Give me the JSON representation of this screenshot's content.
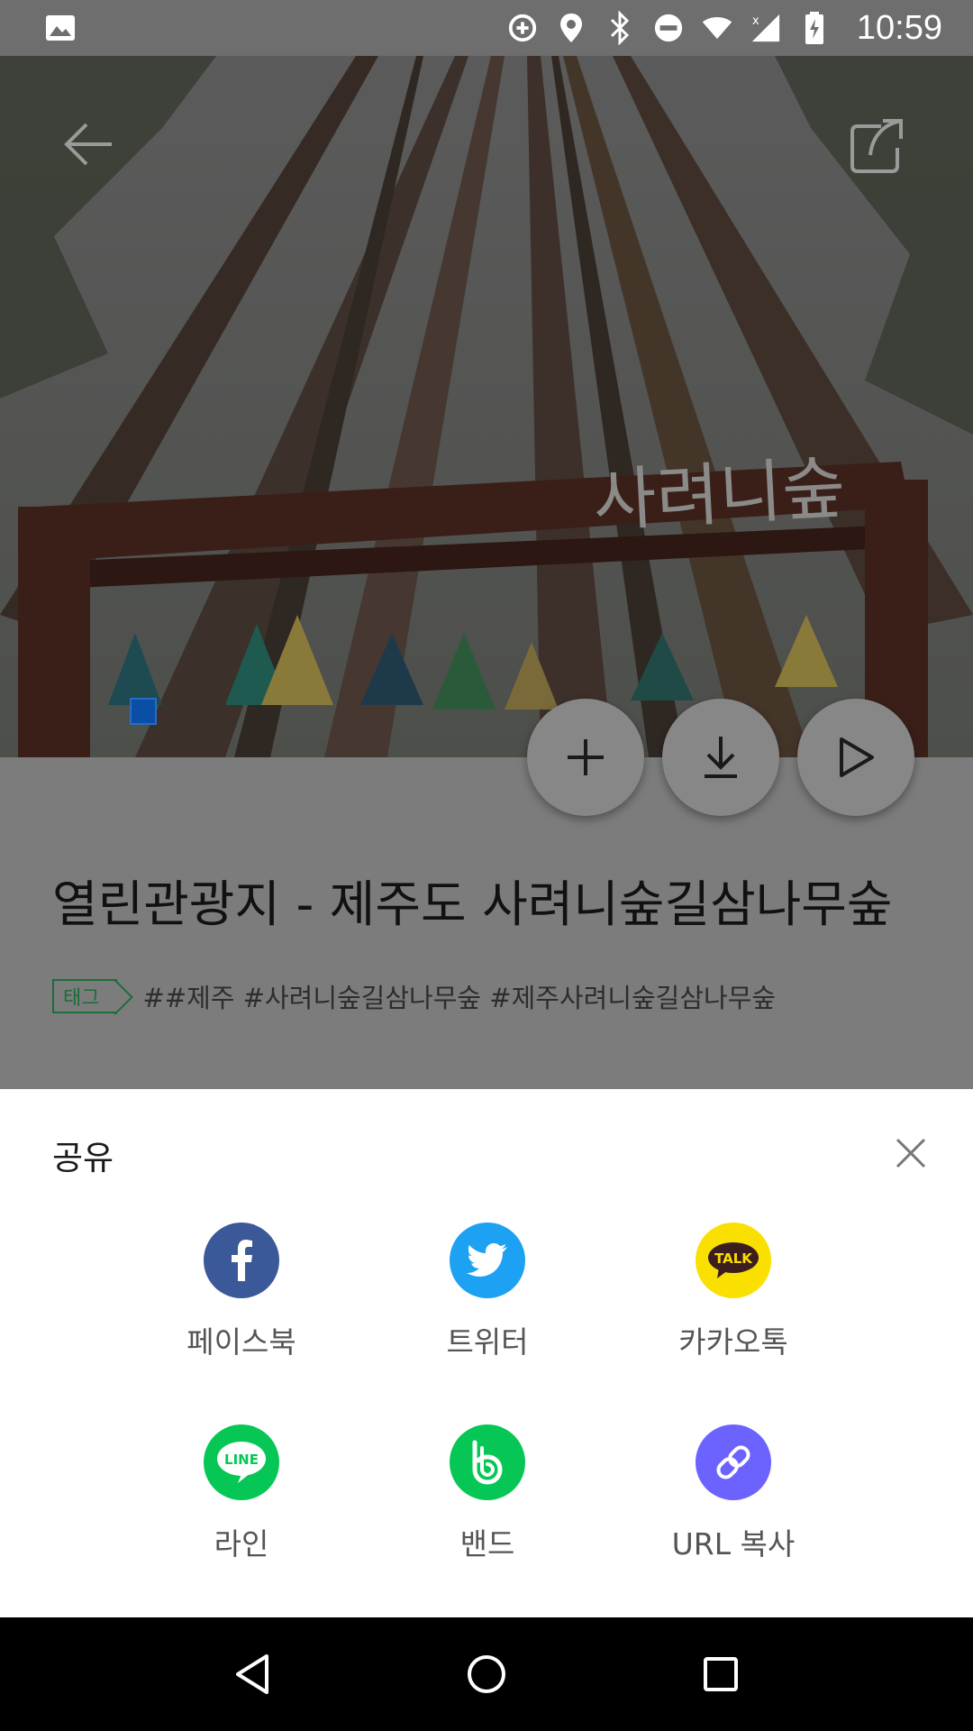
{
  "status_bar": {
    "time": "10:59",
    "icons": [
      "image-icon",
      "data-saver-icon",
      "location-icon",
      "bluetooth-icon",
      "do-not-disturb-icon",
      "wifi-icon",
      "signal-icon",
      "battery-charging-icon"
    ]
  },
  "hero": {
    "sign_text": "사려니숲",
    "back_icon": "arrow-left-icon",
    "share_icon": "share-icon"
  },
  "actions": {
    "add_icon": "plus-icon",
    "download_icon": "download-icon",
    "play_icon": "play-icon"
  },
  "content": {
    "title": "열린관광지 - 제주도 사려니숲길삼나무숲",
    "tag_badge": "태그",
    "tags": "##제주 #사려니숲길삼나무숲 #제주사려니숲길삼나무숲"
  },
  "share_sheet": {
    "title": "공유",
    "close_icon": "close-icon",
    "items": [
      {
        "label": "페이스북",
        "icon": "facebook-icon",
        "color": "#3b5998"
      },
      {
        "label": "트위터",
        "icon": "twitter-icon",
        "color": "#1da1f2"
      },
      {
        "label": "카카오톡",
        "icon": "kakaotalk-icon",
        "color": "#f9e000",
        "glyph": "TALK"
      },
      {
        "label": "라인",
        "icon": "line-icon",
        "color": "#06c755",
        "glyph": "LINE"
      },
      {
        "label": "밴드",
        "icon": "band-icon",
        "color": "#06c755"
      },
      {
        "label": "URL 복사",
        "icon": "link-icon",
        "color": "#6c63ff"
      }
    ]
  },
  "nav_bar": {
    "icons": [
      "back-triangle-icon",
      "home-circle-icon",
      "recents-square-icon"
    ]
  }
}
